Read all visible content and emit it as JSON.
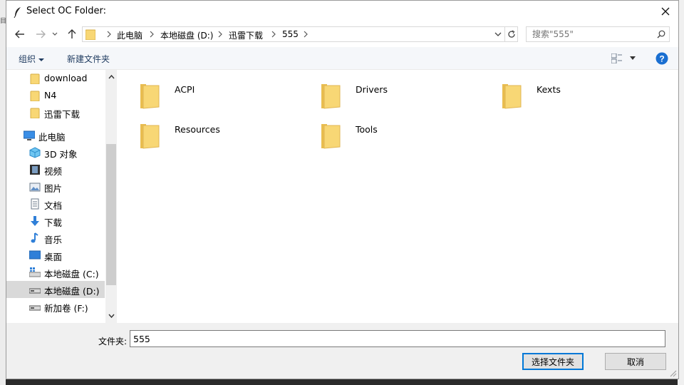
{
  "window": {
    "title": "Select OC Folder:",
    "background_char": "目"
  },
  "nav": {
    "back_icon": "arrow-left-icon",
    "forward_icon": "arrow-right-icon",
    "recent_icon": "chevron-down-icon",
    "up_icon": "arrow-up-icon",
    "breadcrumbs": [
      "此电脑",
      "本地磁盘 (D:)",
      "迅雷下载",
      "555"
    ],
    "search_placeholder": "搜索\"555\""
  },
  "toolbar": {
    "organize_label": "组织",
    "new_folder_label": "新建文件夹"
  },
  "sidebar": {
    "items": [
      {
        "label": "download",
        "icon": "folder-icon"
      },
      {
        "label": "N4",
        "icon": "folder-icon"
      },
      {
        "label": "迅雷下载",
        "icon": "folder-icon"
      },
      {
        "label": "此电脑",
        "icon": "computer-icon"
      },
      {
        "label": "3D 对象",
        "icon": "cube-3d-icon"
      },
      {
        "label": "视频",
        "icon": "video-icon"
      },
      {
        "label": "图片",
        "icon": "picture-icon"
      },
      {
        "label": "文档",
        "icon": "document-icon"
      },
      {
        "label": "下载",
        "icon": "download-arrow-icon"
      },
      {
        "label": "音乐",
        "icon": "music-note-icon"
      },
      {
        "label": "桌面",
        "icon": "desktop-icon"
      },
      {
        "label": "本地磁盘 (C:)",
        "icon": "windows-drive-icon"
      },
      {
        "label": "本地磁盘 (D:)",
        "icon": "drive-icon",
        "selected": true
      },
      {
        "label": "新加卷 (F:)",
        "icon": "drive-icon"
      }
    ]
  },
  "folders": [
    {
      "name": "ACPI"
    },
    {
      "name": "Drivers"
    },
    {
      "name": "Kexts"
    },
    {
      "name": "Resources"
    },
    {
      "name": "Tools"
    }
  ],
  "footer": {
    "folder_label": "文件夹:",
    "folder_value": "555",
    "select_button": "选择文件夹",
    "cancel_button": "取消"
  },
  "colors": {
    "accent": "#0078d7",
    "folder_yellow": "#f8d775",
    "help_blue": "#1a6fd1"
  }
}
